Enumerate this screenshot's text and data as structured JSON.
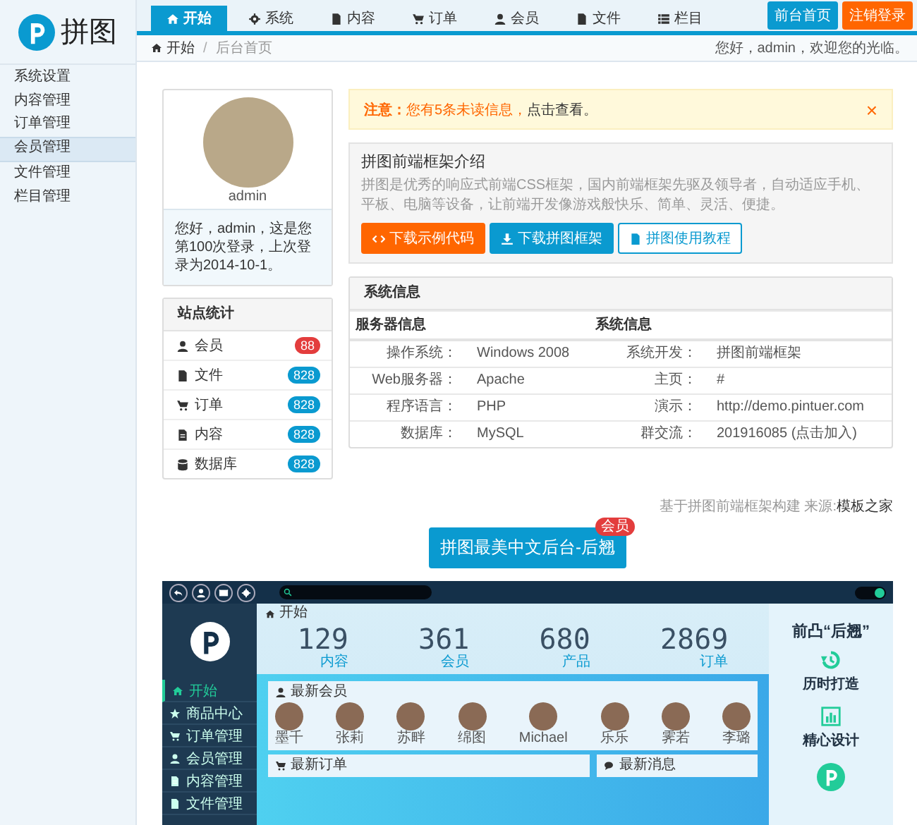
{
  "logo": {
    "text": "拼图"
  },
  "nav": {
    "tabs": [
      {
        "label": "开始",
        "selected": true
      },
      {
        "label": "系统",
        "selected": false
      },
      {
        "label": "内容",
        "selected": false
      },
      {
        "label": "订单",
        "selected": false
      },
      {
        "label": "会员",
        "selected": false
      },
      {
        "label": "文件",
        "selected": false
      },
      {
        "label": "栏目",
        "selected": false
      }
    ],
    "buttons": [
      {
        "label": "前台首页",
        "kind": "primary"
      },
      {
        "label": "注销登录",
        "kind": "warning"
      }
    ]
  },
  "breadcrumb": {
    "items": [
      "开始",
      "后台首页"
    ],
    "separator": "/",
    "greeting": "您好，admin，欢迎您的光临。"
  },
  "sidebar": {
    "items": [
      {
        "label": "系统设置",
        "selected": false
      },
      {
        "label": "内容管理",
        "selected": false
      },
      {
        "label": "订单管理",
        "selected": false
      },
      {
        "label": "会员管理",
        "selected": true
      },
      {
        "label": "文件管理",
        "selected": false
      },
      {
        "label": "栏目管理",
        "selected": false
      }
    ]
  },
  "profile": {
    "name": "admin",
    "message": "您好，admin，这是您第100次登录，上次登录为2014-10-1。"
  },
  "stats": {
    "title": "站点统计",
    "items": [
      {
        "label": "会员",
        "count": "88",
        "color": "#e33d3d"
      },
      {
        "label": "文件",
        "count": "828",
        "color": "#0a9ad0"
      },
      {
        "label": "订单",
        "count": "828",
        "color": "#0a9ad0"
      },
      {
        "label": "内容",
        "count": "828",
        "color": "#0a9ad0"
      },
      {
        "label": "数据库",
        "count": "828",
        "color": "#0a9ad0"
      }
    ]
  },
  "alert": {
    "text": "**注意：**您有5条未读信息，",
    "link": "点击查看。",
    "close": "×"
  },
  "intro": {
    "title": "拼图前端框架介绍",
    "text": "拼图是优秀的响应式前端CSS框架，国内前端框架先驱及领导者，自动适应手机、平板、电脑等设备，让前端开发像游戏般快乐、简单、灵活、便捷。",
    "buttons": [
      {
        "label": "下载示例代码",
        "kind": "warning"
      },
      {
        "label": "下载拼图框架",
        "kind": "primary"
      },
      {
        "label": "拼图使用教程",
        "kind": "outline"
      }
    ]
  },
  "system_info": {
    "title": "系统信息",
    "columns": [
      "服务器信息",
      "系统信息"
    ],
    "rows": [
      {
        "label_1": "操作系统：",
        "value_1": "Windows 2008",
        "label_2": "系统开发：",
        "value_2": "拼图前端框架"
      },
      {
        "label_1": "Web服务器：",
        "value_1": "Apache",
        "label_2": "主页：",
        "value_2": "#"
      },
      {
        "label_1": "程序语言：",
        "value_1": "PHP",
        "label_2": "演示：",
        "value_2": "http://demo.pintuer.com"
      },
      {
        "label_1": "数据库：",
        "value_1": "MySQL",
        "label_2": "群交流：",
        "value_2": "201916085 (点击加入)"
      }
    ]
  },
  "footer": {
    "text": "基于拼图前端框架构建 来源:",
    "link": "模板之家"
  },
  "feature_button": {
    "label": "拼图最美中文后台-后翘",
    "badge": "会员"
  },
  "preview": {
    "breadcrumb": "开始",
    "toggle": {
      "on": true
    },
    "menu": [
      {
        "label": "开始",
        "selected": true
      },
      {
        "label": "商品中心",
        "selected": false
      },
      {
        "label": "订单管理",
        "selected": false
      },
      {
        "label": "会员管理",
        "selected": false
      },
      {
        "label": "内容管理",
        "selected": false
      },
      {
        "label": "文件管理",
        "selected": false
      }
    ],
    "stats": [
      {
        "value": "129",
        "label": "内容"
      },
      {
        "value": "361",
        "label": "会员"
      },
      {
        "value": "680",
        "label": "产品"
      },
      {
        "value": "2869",
        "label": "订单"
      }
    ],
    "members_title": "最新会员",
    "members": [
      {
        "name": "墨千"
      },
      {
        "name": "张莉"
      },
      {
        "name": "苏畔"
      },
      {
        "name": "绵图"
      },
      {
        "name": "Michael"
      },
      {
        "name": "乐乐"
      },
      {
        "name": "霁若"
      },
      {
        "name": "李璐"
      }
    ],
    "panels": [
      "最新订单",
      "最新消息"
    ],
    "side_title": "前凸“后翘”",
    "features": [
      "历时打造",
      "精心设计"
    ]
  }
}
